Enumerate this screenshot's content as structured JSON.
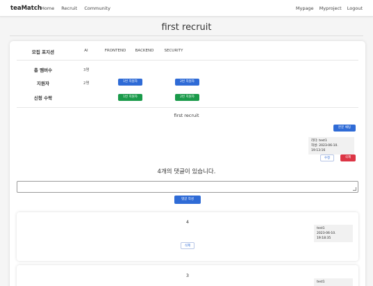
{
  "navbar": {
    "brand": "teaMatch",
    "links": [
      "Home",
      "Recruit",
      "Community"
    ],
    "right_links": [
      "Mypage",
      "Myproject",
      "Logout"
    ]
  },
  "page_title": "first recruit",
  "recruit": {
    "position_label": "모집 포지션",
    "positions": [
      "AI",
      "FRONTEND",
      "BACKEND",
      "SECURITY"
    ],
    "total_label": "총 멤버수",
    "total_value": "3명",
    "applicant_label": "지원자",
    "applicant_value": "2명",
    "applicant_buttons": [
      "1번 지원자",
      "2번 지원자"
    ],
    "accept_label": "신청 수락",
    "accept_buttons": [
      "1번 지원자",
      "2번 지원자"
    ]
  },
  "post": {
    "body": "first recruit",
    "edit_button": "본문 채팅",
    "leader_line": "리더: test1",
    "created_line": "작성: 2023-06-10. 19:13:16",
    "modify_button": "수정",
    "delete_button": "삭제"
  },
  "comments": {
    "count_text": "4개의 댓글이 있습니다.",
    "input_placeholder": "",
    "submit_button": "댓글 작성",
    "items": [
      {
        "number": "4",
        "author": "test1",
        "date": "2023-06-10. 19:18:35",
        "delete_label": "삭제"
      },
      {
        "number": "3",
        "author": "test1",
        "date": "",
        "delete_label": ""
      }
    ]
  },
  "colors": {
    "primary": "#2f6bd6",
    "success": "#1a9a4a",
    "danger": "#dc3545"
  }
}
